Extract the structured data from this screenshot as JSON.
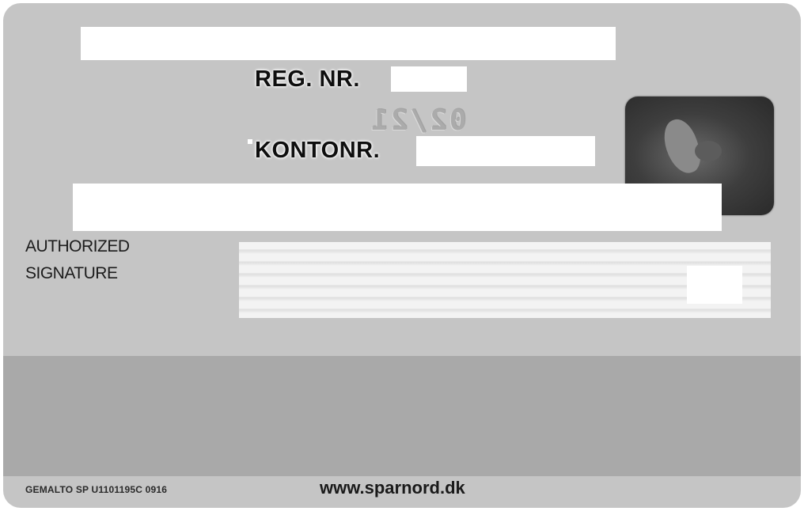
{
  "card": {
    "background": "#c5c5c5",
    "magnetic_stripe_color": "#a9a9a9"
  },
  "fields": {
    "reg_label": "REG. NR.",
    "kontonr_label": "KONTONR.",
    "expiry": "02/21"
  },
  "signature": {
    "label_line1": "AUTHORIZED",
    "label_line2": "SIGNATURE"
  },
  "hologram": {
    "icon": "dove-hologram-icon"
  },
  "footer": {
    "manufacturer_code": "GEMALTO SP U1101195C 0916",
    "website": "www.sparnord.dk"
  }
}
